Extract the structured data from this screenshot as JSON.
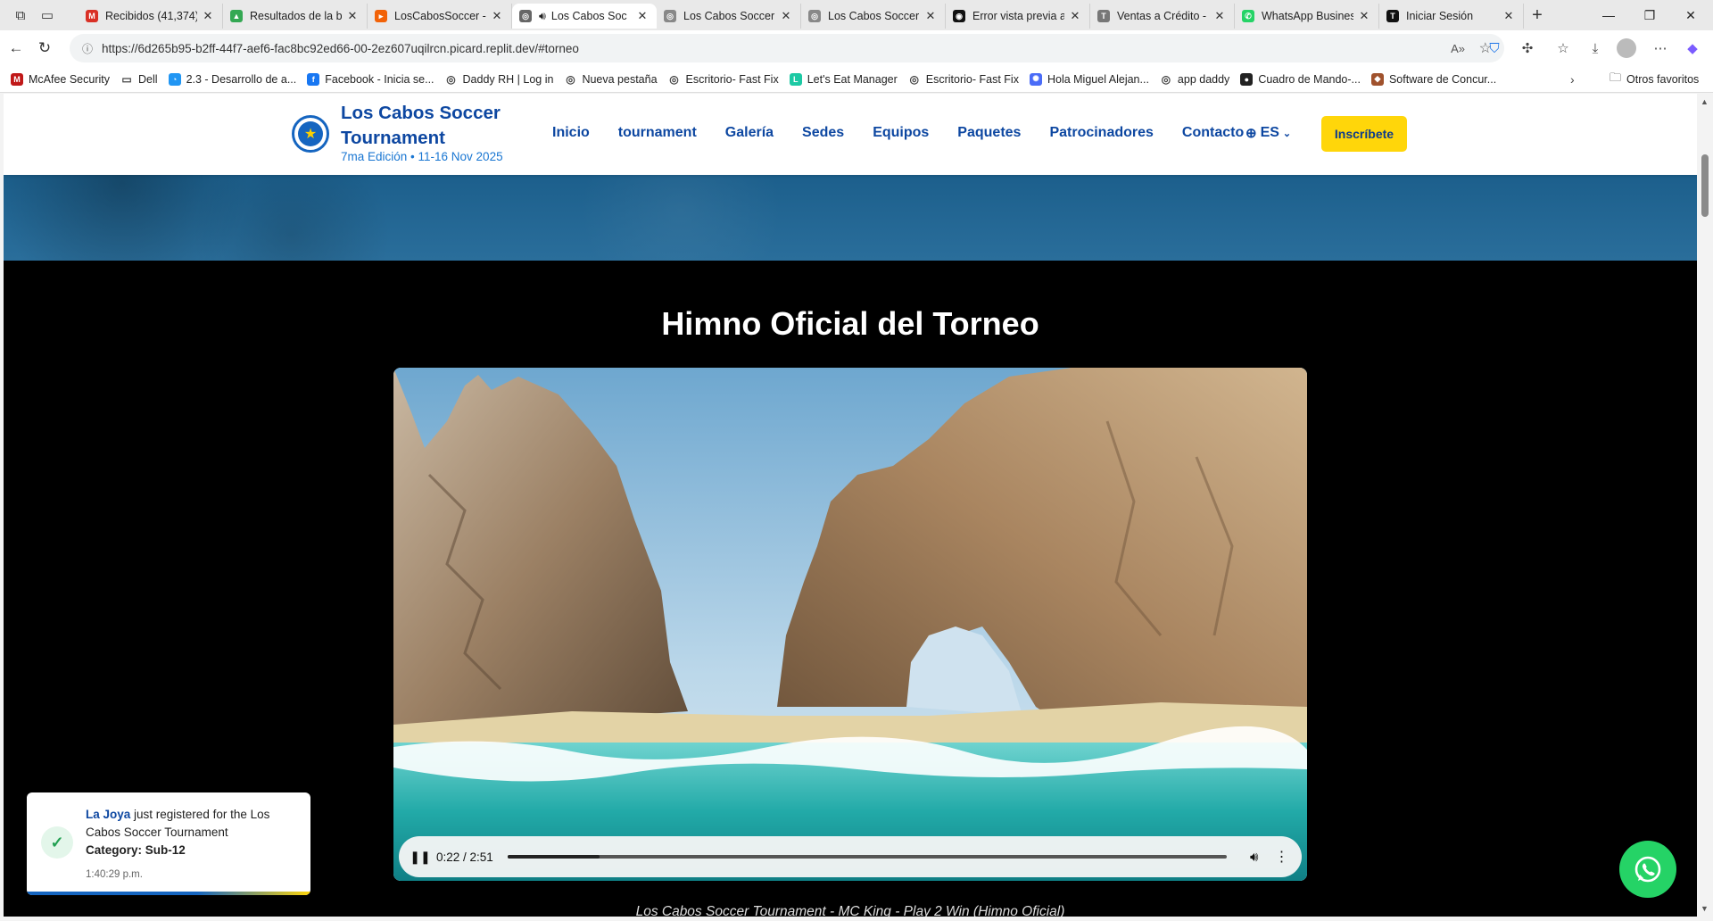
{
  "browser": {
    "tabs": [
      {
        "title": "Recibidos (41,374)",
        "color": "#d93025",
        "glyph": "M"
      },
      {
        "title": "Resultados de la bús",
        "color": "#34a853",
        "glyph": "▲"
      },
      {
        "title": "LosCabosSoccer - R",
        "color": "#f26207",
        "glyph": "▸"
      },
      {
        "title": "Los Cabos Soc",
        "color": "#666666",
        "glyph": "◎",
        "active": true,
        "audio": true
      },
      {
        "title": "Los Cabos Soccer T",
        "color": "#888888",
        "glyph": "◎"
      },
      {
        "title": "Los Cabos Soccer T",
        "color": "#888888",
        "glyph": "◎"
      },
      {
        "title": "Error vista previa a",
        "color": "#111111",
        "glyph": "◉"
      },
      {
        "title": "Ventas a Crédito -",
        "color": "#777777",
        "glyph": "T"
      },
      {
        "title": "WhatsApp Business",
        "color": "#25d366",
        "glyph": "✆"
      },
      {
        "title": "Iniciar Sesión",
        "color": "#111111",
        "glyph": "T"
      }
    ],
    "url": "https://6d265b95-b2ff-44f7-aef6-fac8bc92ed66-00-2ez607uqilrcn.picard.replit.dev/#torneo",
    "bookmarks": [
      {
        "label": "McAfee Security",
        "color": "#c01818",
        "glyph": "M"
      },
      {
        "label": "Dell",
        "color": "#ffffff",
        "glyph": "▭"
      },
      {
        "label": "2.3 - Desarrollo de a...",
        "color": "#2196f3",
        "glyph": "◔"
      },
      {
        "label": "Facebook - Inicia se...",
        "color": "#1877f2",
        "glyph": "f"
      },
      {
        "label": "Daddy RH | Log in",
        "color": "#ffffff",
        "glyph": "◎"
      },
      {
        "label": "Nueva pestaña",
        "color": "#ffffff",
        "glyph": "◎"
      },
      {
        "label": "Escritorio- Fast Fix",
        "color": "#ffffff",
        "glyph": "◎"
      },
      {
        "label": "Let's Eat Manager",
        "color": "#1dc9a4",
        "glyph": "L"
      },
      {
        "label": "Escritorio- Fast Fix",
        "color": "#ffffff",
        "glyph": "◎"
      },
      {
        "label": "Hola Miguel Alejan...",
        "color": "#4a6cf7",
        "glyph": "✺"
      },
      {
        "label": "app daddy",
        "color": "#ffffff",
        "glyph": "◎"
      },
      {
        "label": "Cuadro de Mando-...",
        "color": "#222222",
        "glyph": "●"
      },
      {
        "label": "Software de Concur...",
        "color": "#a0522d",
        "glyph": "◆"
      }
    ],
    "other_favorites": "Otros favoritos"
  },
  "site": {
    "brand_title": "Los Cabos Soccer Tournament",
    "brand_subtitle": "7ma Edición • 11-16 Nov 2025",
    "nav": [
      "Inicio",
      "tournament",
      "Galería",
      "Sedes",
      "Equipos",
      "Paquetes",
      "Patrocinadores",
      "Contacto"
    ],
    "lang": "ES",
    "cta": "Inscríbete",
    "colors": {
      "primary": "#0d47a1",
      "accent": "#ffd60a"
    }
  },
  "anthem": {
    "title": "Himno Oficial del Torneo",
    "time": "0:22 / 2:51",
    "progress": 0.128,
    "caption": "Los Cabos Soccer Tournament - MC King - Play 2 Win (Himno Oficial)"
  },
  "toast": {
    "team": "La Joya",
    "message": " just registered for the Los Cabos Soccer Tournament",
    "category": "Category: Sub-12",
    "time": "1:40:29 p.m."
  }
}
